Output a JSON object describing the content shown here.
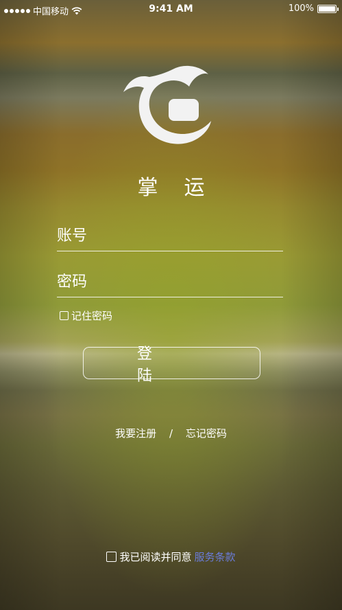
{
  "status_bar": {
    "carrier": "中国移动",
    "time": "9:41 AM",
    "battery": "100%",
    "battery_level": 1.0
  },
  "app": {
    "name": "掌运"
  },
  "login_form": {
    "account_placeholder": "账号",
    "password_placeholder": "密码",
    "remember_label": "记住密码",
    "login_button": "登陆"
  },
  "links": {
    "register": "我要注册",
    "separator": "/",
    "forgot_password": "忘记密码"
  },
  "agreement": {
    "text": "我已阅读并同意",
    "terms_link": "服务条款"
  },
  "colors": {
    "link_accent": "#6a7cdb",
    "text": "#ffffff"
  }
}
